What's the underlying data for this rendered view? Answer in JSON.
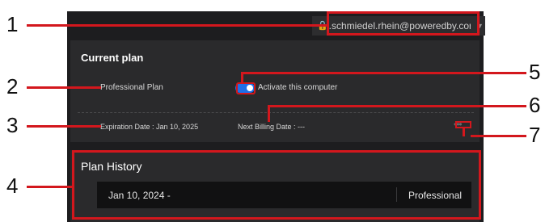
{
  "account": {
    "email": "j.schmiedel.rhein@poweredby.com",
    "icon": "lock-icon",
    "dropdown_icon": "chevron-down-icon"
  },
  "current_plan": {
    "title": "Current plan",
    "plan_name": "Professional Plan",
    "activate_label": "Activate this computer",
    "activate_on": true,
    "expiration": "Expiration Date : Jan 10, 2025",
    "next_billing": "Next Billing Date : ---",
    "more_icon": "more-dots-icon"
  },
  "plan_history": {
    "title": "Plan History",
    "rows": [
      {
        "date": "Jan 10, 2024 -",
        "plan": "Professional"
      }
    ]
  },
  "callouts": [
    "1",
    "2",
    "3",
    "4",
    "5",
    "6",
    "7"
  ],
  "colors": {
    "panel_bg": "#1d1d1f",
    "card_bg": "#2a2a2c",
    "toggle_on": "#1e6fe8",
    "annotation_red": "#d3171d"
  }
}
